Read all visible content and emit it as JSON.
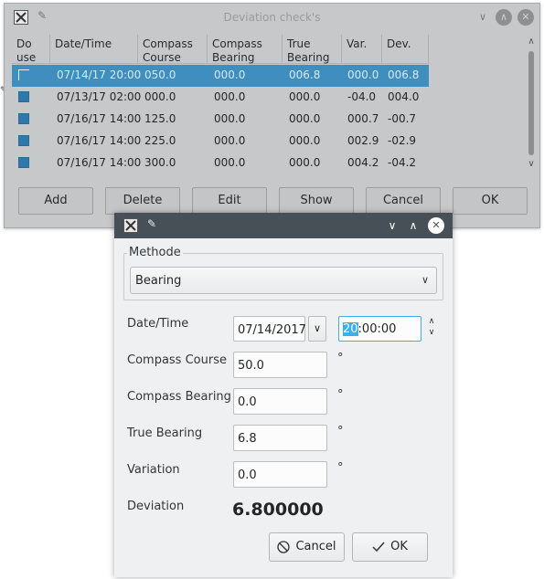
{
  "background_window": {
    "title": "Deviation check's",
    "columns": [
      "Do\nuse",
      "Date/Time",
      "Compass\nCourse",
      "Compass\nBearing",
      "True\nBearing",
      "Var.",
      "Dev."
    ],
    "rows": [
      {
        "selected": true,
        "datetime": "07/14/17 20:00",
        "compass_course": "050.0",
        "compass_bearing": "000.0",
        "true_bearing": "006.8",
        "var": "000.0",
        "dev": "006.8"
      },
      {
        "selected": false,
        "datetime": "07/13/17 02:00",
        "compass_course": "000.0",
        "compass_bearing": "000.0",
        "true_bearing": "000.0",
        "var": "-04.0",
        "dev": "004.0"
      },
      {
        "selected": false,
        "datetime": "07/16/17 14:00",
        "compass_course": "125.0",
        "compass_bearing": "000.0",
        "true_bearing": "000.0",
        "var": "000.7",
        "dev": "-00.7"
      },
      {
        "selected": false,
        "datetime": "07/16/17 14:00",
        "compass_course": "225.0",
        "compass_bearing": "000.0",
        "true_bearing": "000.0",
        "var": "002.9",
        "dev": "-02.9"
      },
      {
        "selected": false,
        "datetime": "07/16/17 14:00",
        "compass_course": "300.0",
        "compass_bearing": "000.0",
        "true_bearing": "000.0",
        "var": "004.2",
        "dev": "-04.2"
      }
    ],
    "buttons": {
      "add": "Add",
      "delete": "Delete",
      "edit": "Edit",
      "show": "Show",
      "cancel": "Cancel",
      "ok": "OK"
    }
  },
  "dialog": {
    "group_label": "Methode",
    "method_value": "Bearing",
    "date_label": "Date/Time",
    "date_value": "07/14/2017",
    "time_hour": "20",
    "time_rest": ":00:00",
    "compass_course_label": "Compass Course",
    "compass_course_value": "50.0",
    "compass_bearing_label": "Compass Bearing",
    "compass_bearing_value": "0.0",
    "true_bearing_label": "True Bearing",
    "true_bearing_value": "6.8",
    "variation_label": "Variation",
    "variation_value": "0.0",
    "deviation_label": "Deviation",
    "deviation_value": "6.800000",
    "unit": "°",
    "cancel_label": "Cancel",
    "ok_label": "OK"
  },
  "icons": {
    "app": "x-logo-icon",
    "pin": "pin-icon",
    "minimize": "chevron-down-icon",
    "maximize": "chevron-up-icon",
    "close": "close-icon",
    "cancel": "cancel-circle-icon",
    "ok": "checkmark-icon"
  },
  "colors": {
    "selection": "#3e8fbf",
    "checkbox": "#2f79aa",
    "dialog_titlebar": "#475057",
    "focus": "#3daee9"
  }
}
